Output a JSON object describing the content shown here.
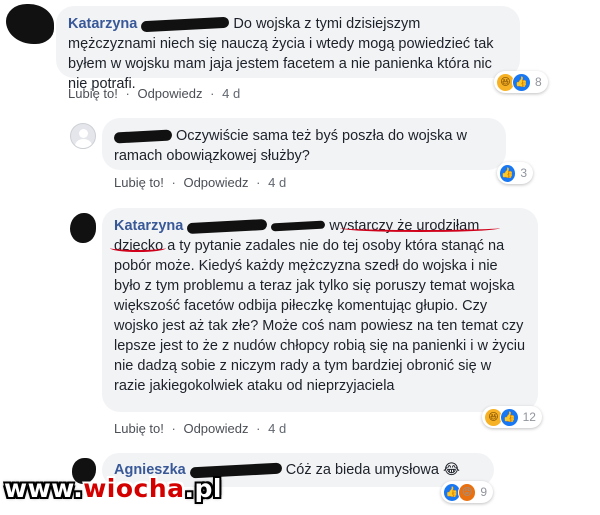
{
  "comments": [
    {
      "author": "Katarzyna",
      "text": "Do wojska z tymi dzisiejszym mężczyznami niech się nauczą życia i wtedy mogą powiedzieć tak byłem w wojsku mam jaja jestem facetem a nie panienka która nic nie potrafi.",
      "like_label": "Lubię to!",
      "reply_label": "Odpowiedz",
      "time": "4 d",
      "reaction_count": "8"
    },
    {
      "author": "",
      "text": "Oczywiście sama też byś poszła do wojska w ramach obowiązkowej służby?",
      "like_label": "Lubię to!",
      "reply_label": "Odpowiedz",
      "time": "4 d",
      "reaction_count": "3"
    },
    {
      "author": "Katarzyna",
      "text_part1": "wystarczy że urodziłam dziecko",
      "text_part2": " a ty pytanie zadales nie do tej osoby która stanąć na pobór może. Kiedyś każdy mężczyzna szedł do wojska i nie było z tym problemu a teraz jak tylko się poruszy temat wojska większość facetów odbija piłeczkę komentując głupio. Czy wojsko jest aż tak złe? Może coś nam powiesz na ten temat czy lepsze jest to że z nudów chłopcy robią się na panienki i w życiu nie dadzą sobie z niczym rady a tym bardziej obronić się w razie jakiegokolwiek ataku od nieprzyjaciela",
      "like_label": "Lubię to!",
      "reply_label": "Odpowiedz",
      "time": "4 d",
      "reaction_count": "12"
    },
    {
      "author": "Agnieszka",
      "text": "Cóż za bieda umysłowa 😂",
      "reaction_count": "9"
    }
  ],
  "watermark": {
    "prefix": "www.",
    "accent": "wiocha",
    "suffix": ".pl"
  },
  "colors": {
    "author": "#385898",
    "bubble": "#f2f3f5",
    "like": "#1877f2",
    "haha": "#f7b125",
    "underline": "#d0021b"
  }
}
